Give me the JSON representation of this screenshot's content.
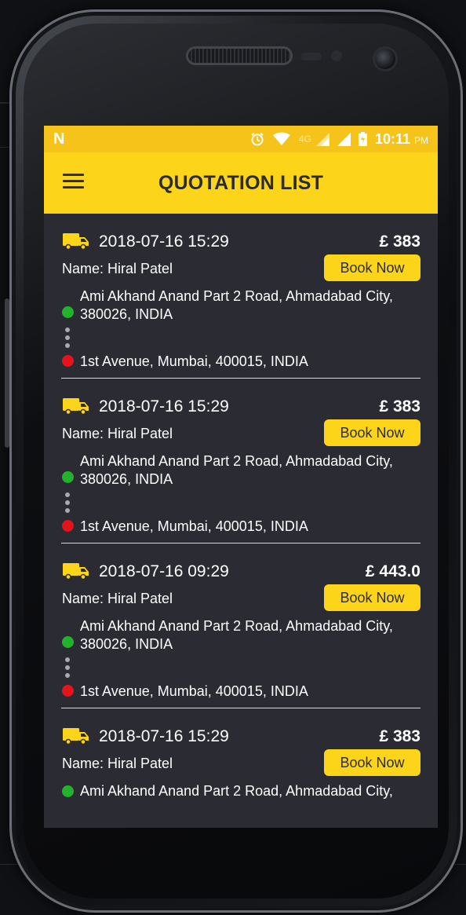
{
  "statusbar": {
    "time": "10:11",
    "ampm": "PM",
    "network": "4G",
    "app_icon": "notification-n-icon",
    "icons": [
      "alarm-icon",
      "wifi-icon",
      "signal-icon",
      "battery-icon"
    ]
  },
  "appbar": {
    "title": "QUOTATION LIST",
    "menu_icon": "hamburger-menu-icon",
    "color": "#fcd51a"
  },
  "colors": {
    "accent": "#fcd51a",
    "background": "#2a2b33",
    "pickup": "#22b32a",
    "drop": "#e5141c"
  },
  "quotations": [
    {
      "datetime": "2018-07-16 15:29",
      "price": "£ 383",
      "name": "Name: Hiral Patel",
      "button": "Book Now",
      "pickup": "Ami Akhand Anand Part 2 Road, Ahmadabad City, 380026, INDIA",
      "drop": "1st Avenue, Mumbai, 400015, INDIA"
    },
    {
      "datetime": "2018-07-16 15:29",
      "price": "£ 383",
      "name": "Name: Hiral Patel",
      "button": "Book Now",
      "pickup": "Ami Akhand Anand Part 2 Road, Ahmadabad City, 380026, INDIA",
      "drop": "1st Avenue, Mumbai, 400015, INDIA"
    },
    {
      "datetime": "2018-07-16 09:29",
      "price": "£ 443.0",
      "name": "Name: Hiral Patel",
      "button": "Book Now",
      "pickup": "Ami Akhand Anand Part 2 Road, Ahmadabad City, 380026, INDIA",
      "drop": "1st Avenue, Mumbai, 400015, INDIA"
    },
    {
      "datetime": "2018-07-16 15:29",
      "price": "£ 383",
      "name": "Name: Hiral Patel",
      "button": "Book Now",
      "pickup": "Ami Akhand Anand Part 2 Road, Ahmadabad City,",
      "drop": ""
    }
  ]
}
